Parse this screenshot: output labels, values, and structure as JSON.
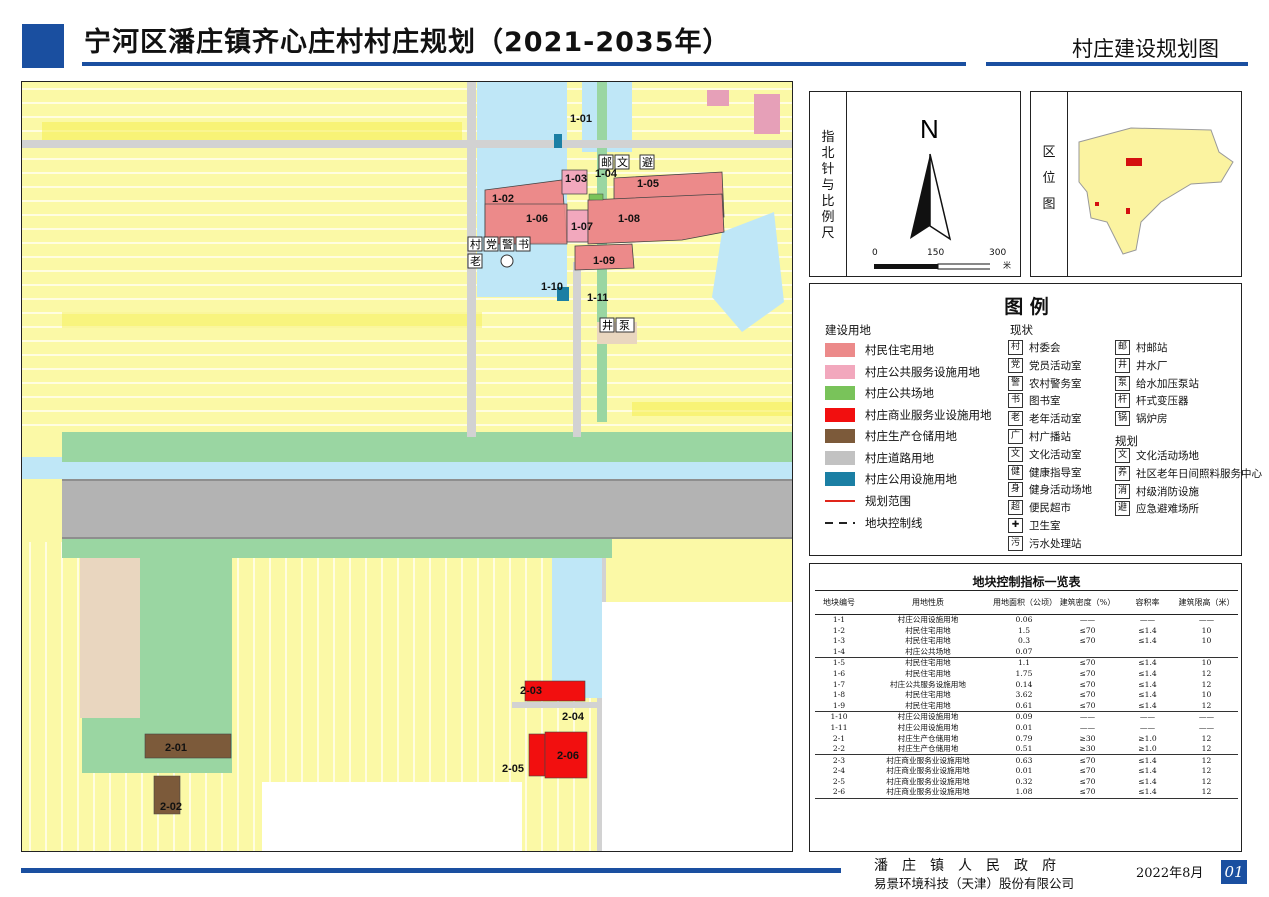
{
  "header": {
    "title": "宁河区潘庄镇齐心庄村村庄规划（2021-2035年）",
    "sheet_name": "村庄建设规划图"
  },
  "colors": {
    "brand_blue": "#1a4fa0",
    "residential": "#ec8a8a",
    "public_service": "#f2a8bd",
    "public_square": "#79c35a",
    "commercial": "#f20f0f",
    "storage": "#7c5a3a",
    "road": "#c2c2c2",
    "utility": "#1b7fa4",
    "farmland": "#fbf9a6",
    "water": "#bfe7f7",
    "green": "#9ad6a2"
  },
  "map": {
    "plot_labels": [
      "1-01",
      "1-02",
      "1-03",
      "1-04",
      "1-05",
      "1-06",
      "1-07",
      "1-08",
      "1-09",
      "1-10",
      "1-11",
      "2-01",
      "2-02",
      "2-03",
      "2-04",
      "2-05",
      "2-06"
    ],
    "poi_glyphs": {
      "village": "村",
      "party": "党",
      "police": "警",
      "library": "书",
      "elderly": "老",
      "culture": "文",
      "well": "井",
      "pump": "泵",
      "shelter": "避",
      "post": "邮"
    }
  },
  "north_panel": {
    "label": "指北针与比例尺",
    "north": "N",
    "scale_ticks": [
      "0",
      "150",
      "300"
    ],
    "scale_unit": "米"
  },
  "location_panel": {
    "label": "区位图"
  },
  "legend": {
    "title": "图 例",
    "land_use_heading": "建设用地",
    "land_use": [
      {
        "label": "村民住宅用地",
        "color": "#ec8a8a"
      },
      {
        "label": "村庄公共服务设施用地",
        "color": "#f2a8bd"
      },
      {
        "label": "村庄公共场地",
        "color": "#79c35a"
      },
      {
        "label": "村庄商业服务业设施用地",
        "color": "#f20f0f"
      },
      {
        "label": "村庄生产仓储用地",
        "color": "#7c5a3a"
      },
      {
        "label": "村庄道路用地",
        "color": "#c2c2c2"
      },
      {
        "label": "村庄公用设施用地",
        "color": "#1b7fa4"
      }
    ],
    "boundary_label": "规划范围",
    "control_line_label": "地块控制线",
    "current_heading": "现状",
    "current_col1": [
      {
        "icon": "村",
        "label": "村委会"
      },
      {
        "icon": "党",
        "label": "党员活动室"
      },
      {
        "icon": "警",
        "label": "农村警务室"
      },
      {
        "icon": "书",
        "label": "图书室"
      },
      {
        "icon": "老",
        "label": "老年活动室"
      },
      {
        "icon": "广",
        "label": "村广播站"
      },
      {
        "icon": "文",
        "label": "文化活动室"
      },
      {
        "icon": "健",
        "label": "健康指导室"
      },
      {
        "icon": "身",
        "label": "健身活动场地"
      },
      {
        "icon": "超",
        "label": "便民超市"
      },
      {
        "icon": "✚",
        "label": "卫生室"
      },
      {
        "icon": "污",
        "label": "污水处理站"
      }
    ],
    "current_col2": [
      {
        "icon": "邮",
        "label": "村邮站"
      },
      {
        "icon": "井",
        "label": "井水厂"
      },
      {
        "icon": "泵",
        "label": "给水加压泵站"
      },
      {
        "icon": "杆",
        "label": "杆式变压器"
      },
      {
        "icon": "锅",
        "label": "锅炉房"
      }
    ],
    "planned_heading": "规划",
    "planned": [
      {
        "icon": "文",
        "label": "文化活动场地"
      },
      {
        "icon": "养",
        "label": "社区老年日间照料服务中心"
      },
      {
        "icon": "消",
        "label": "村级消防设施"
      },
      {
        "icon": "避",
        "label": "应急避难场所"
      }
    ]
  },
  "control_table": {
    "title": "地块控制指标一览表",
    "headers": [
      "地块编号",
      "用地性质",
      "用地面积（公顷）",
      "建筑密度（%）",
      "容积率",
      "建筑限高（米）"
    ],
    "rows": [
      [
        "1-1",
        "村庄公用设施用地",
        "0.06",
        "——",
        "——",
        "——"
      ],
      [
        "1-2",
        "村民住宅用地",
        "1.5",
        "≤70",
        "≤1.4",
        "10"
      ],
      [
        "1-3",
        "村民住宅用地",
        "0.3",
        "≤70",
        "≤1.4",
        "10"
      ],
      [
        "1-4",
        "村庄公共场地",
        "0.07",
        "",
        "",
        ""
      ],
      [
        "1-5",
        "村民住宅用地",
        "1.1",
        "≤70",
        "≤1.4",
        "10"
      ],
      [
        "1-6",
        "村民住宅用地",
        "1.75",
        "≤70",
        "≤1.4",
        "12"
      ],
      [
        "1-7",
        "村庄公共服务设施用地",
        "0.14",
        "≤70",
        "≤1.4",
        "12"
      ],
      [
        "1-8",
        "村民住宅用地",
        "3.62",
        "≤70",
        "≤1.4",
        "10"
      ],
      [
        "1-9",
        "村民住宅用地",
        "0.61",
        "≤70",
        "≤1.4",
        "12"
      ],
      [
        "1-10",
        "村庄公用设施用地",
        "0.09",
        "——",
        "——",
        "——"
      ],
      [
        "1-11",
        "村庄公用设施用地",
        "0.01",
        "——",
        "——",
        "——"
      ],
      [
        "2-1",
        "村庄生产仓储用地",
        "0.79",
        "≥30",
        "≥1.0",
        "12"
      ],
      [
        "2-2",
        "村庄生产仓储用地",
        "0.51",
        "≥30",
        "≥1.0",
        "12"
      ],
      [
        "2-3",
        "村庄商业服务业设施用地",
        "0.63",
        "≤70",
        "≤1.4",
        "12"
      ],
      [
        "2-4",
        "村庄商业服务业设施用地",
        "0.01",
        "≤70",
        "≤1.4",
        "12"
      ],
      [
        "2-5",
        "村庄商业服务业设施用地",
        "0.32",
        "≤70",
        "≤1.4",
        "12"
      ],
      [
        "2-6",
        "村庄商业服务业设施用地",
        "1.08",
        "≤70",
        "≤1.4",
        "12"
      ]
    ]
  },
  "footer": {
    "org1": "潘庄镇人民政府",
    "org2": "易景环境科技（天津）股份有限公司",
    "date": "2022年8月",
    "page": "01"
  }
}
